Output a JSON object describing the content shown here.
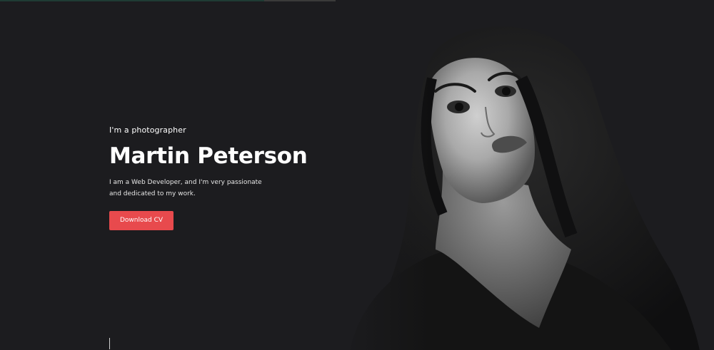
{
  "hero": {
    "subtitle": "I'm a photographer",
    "name": "Martin Peterson",
    "intro": "I am a Web Developer, and I'm very passionate and dedicated to my work.",
    "cta_label": "Download CV"
  },
  "portrait": {
    "icon": "portrait-photo"
  },
  "colors": {
    "background": "#1c1c1f",
    "accent": "#e84a4d",
    "text": "#ffffff"
  }
}
